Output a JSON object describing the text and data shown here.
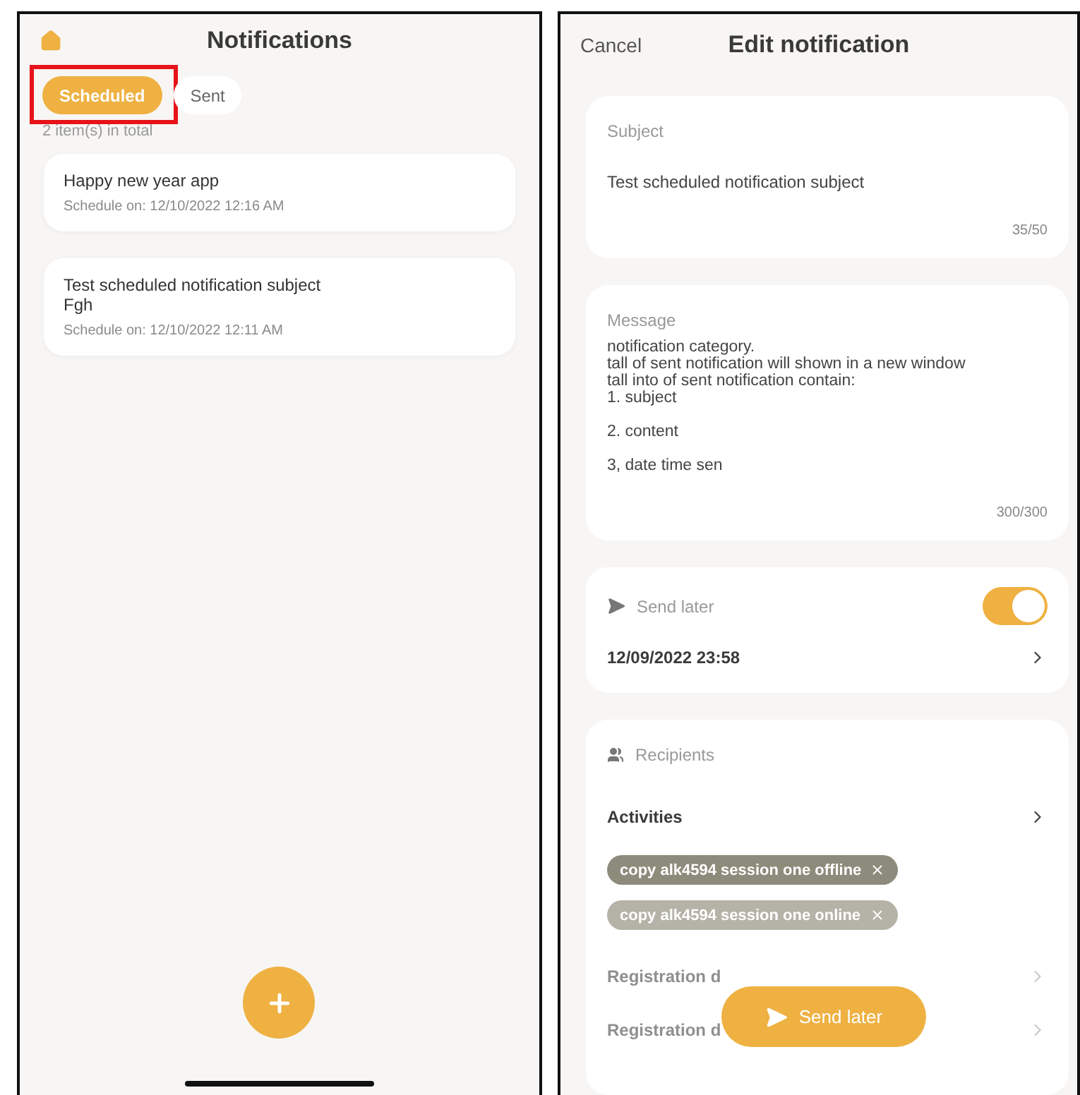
{
  "list_screen": {
    "title": "Notifications",
    "tabs": [
      {
        "label": "Scheduled",
        "selected": true,
        "highlighted": true
      },
      {
        "label": "Sent",
        "selected": false,
        "highlighted": false
      }
    ],
    "count": "2 item(s) in total",
    "notifications": [
      {
        "lines": [
          "Happy new year app"
        ],
        "schedule": "Schedule on: 12/10/2022 12:16 AM"
      },
      {
        "lines": [
          "Test scheduled notification subject",
          "Fgh"
        ],
        "schedule": "Schedule on: 12/10/2022 12:11 AM"
      }
    ]
  },
  "edit_screen": {
    "cancel": "Cancel",
    "title": "Edit notification",
    "subject": {
      "label": "Subject",
      "value": "Test scheduled notification subject",
      "counter": "35/50"
    },
    "message": {
      "label": "Message",
      "paragraphs": [
        "notification category.\ntall of sent notification will shown in a new window\ntall into of sent notification contain:\n1. subject",
        "2. content",
        "3, date time sen"
      ],
      "counter": "300/300"
    },
    "send_later": {
      "label": "Send later",
      "on": true,
      "datetime": "12/09/2022 23:58"
    },
    "recipients": {
      "label": "Recipients",
      "activities": "Activities",
      "chips": [
        {
          "label": "copy alk4594 session one offline",
          "color": "#8d8b7b"
        },
        {
          "label": "copy alk4594 session one online",
          "color": "#b5b3a8"
        }
      ],
      "rows": [
        {
          "label": "Registration d"
        },
        {
          "label": "Registration d"
        }
      ]
    },
    "send_button": "Send later"
  }
}
